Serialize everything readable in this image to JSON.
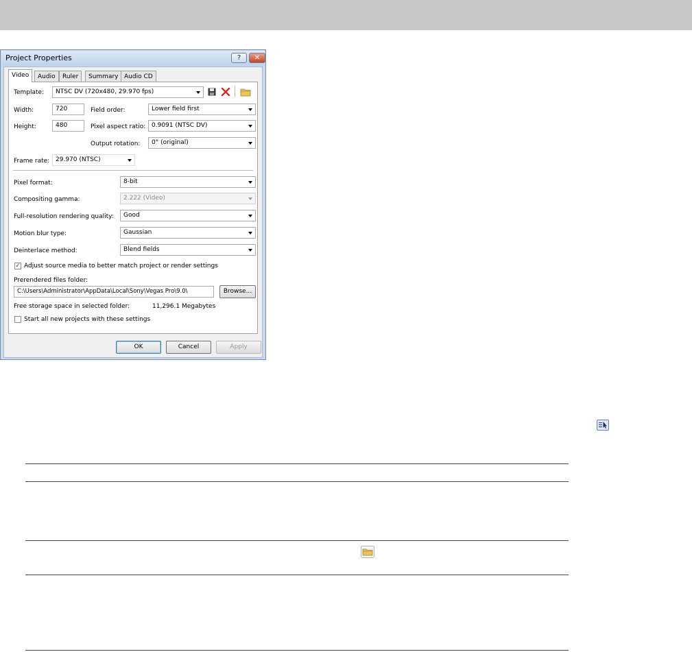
{
  "dialog": {
    "title": "Project Properties",
    "help_glyph": "?",
    "close_glyph": "✕",
    "tabs": [
      "Video",
      "Audio",
      "Ruler",
      "Summary",
      "Audio CD"
    ],
    "template_label": "Template:",
    "template_value": "NTSC DV (720x480, 29.970 fps)",
    "width_label": "Width:",
    "width_value": "720",
    "height_label": "Height:",
    "height_value": "480",
    "field_order_label": "Field order:",
    "field_order_value": "Lower field first",
    "pixel_aspect_label": "Pixel aspect ratio:",
    "pixel_aspect_value": "0.9091 (NTSC DV)",
    "output_rotation_label": "Output rotation:",
    "output_rotation_value": "0° (original)",
    "frame_rate_label": "Frame rate:",
    "frame_rate_value": "29.970 (NTSC)",
    "pixel_format_label": "Pixel format:",
    "pixel_format_value": "8-bit",
    "compositing_gamma_label": "Compositing gamma:",
    "compositing_gamma_value": "2.222 (Video)",
    "rendering_quality_label": "Full-resolution rendering quality:",
    "rendering_quality_value": "Good",
    "motion_blur_label": "Motion blur type:",
    "motion_blur_value": "Gaussian",
    "deinterlace_label": "Deinterlace method:",
    "deinterlace_value": "Blend fields",
    "adjust_source_label": "Adjust source media to better match project or render settings",
    "adjust_source_checked": true,
    "prerendered_label": "Prerendered files folder:",
    "prerendered_path": "C:\\Users\\Administrator\\AppData\\Local\\Sony\\Vegas Pro\\9.0\\",
    "browse_label": "Browse...",
    "free_space_label": "Free storage space in selected folder:",
    "free_space_value": "11,296.1 Megabytes",
    "start_all_label": "Start all new projects with these settings",
    "start_all_checked": false,
    "ok_label": "OK",
    "cancel_label": "Cancel",
    "apply_label": "Apply"
  },
  "icons": {
    "save": "save-icon",
    "delete": "delete-icon",
    "folder": "folder-icon",
    "pointer": "select-pointer-icon"
  },
  "colors": {
    "delete_red": "#d42c1f",
    "folder_yellow": "#e8c45a",
    "title_bar": "#bfd2ec"
  }
}
